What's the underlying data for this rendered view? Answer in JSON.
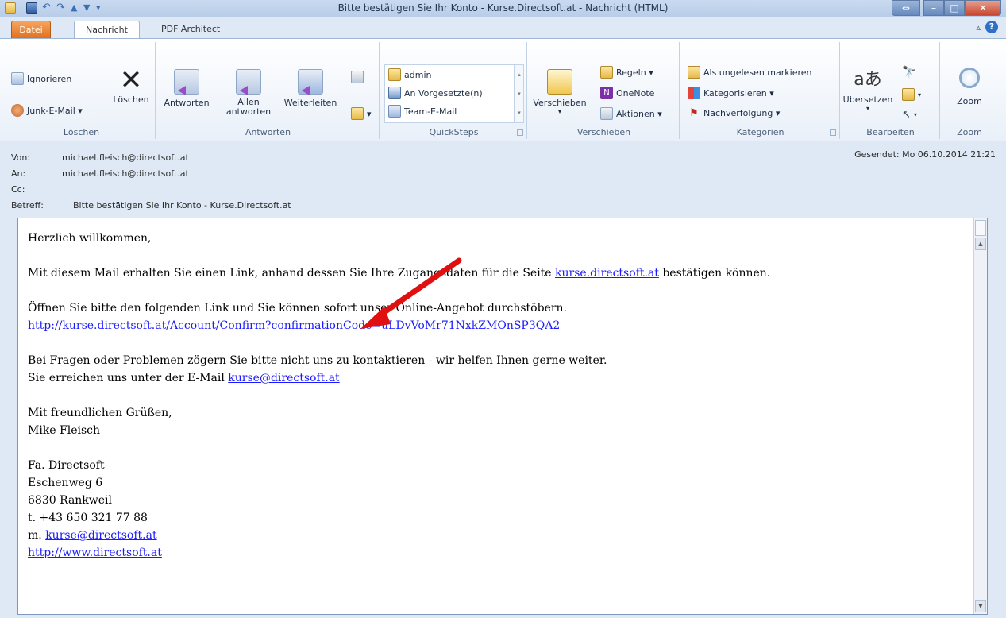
{
  "window": {
    "title": "Bitte bestätigen Sie Ihr Konto - Kurse.Directsoft.at  -  Nachricht (HTML)"
  },
  "tabs": {
    "datei": "Datei",
    "nachricht": "Nachricht",
    "pdf": "PDF Architect"
  },
  "ribbon": {
    "loeschen": {
      "ignorieren": "Ignorieren",
      "junk": "Junk-E-Mail ▾",
      "loeschen": "Löschen",
      "label": "Löschen"
    },
    "antworten": {
      "antworten": "Antworten",
      "allen_line1": "Allen",
      "allen_line2": "antworten",
      "weiterleiten": "Weiterleiten",
      "label": "Antworten"
    },
    "quicksteps": {
      "items": [
        "admin",
        "An Vorgesetzte(n)",
        "Team-E-Mail"
      ],
      "label": "QuickSteps"
    },
    "verschieben": {
      "verschieben": "Verschieben",
      "regeln": "Regeln ▾",
      "onenote": "OneNote",
      "aktionen": "Aktionen ▾",
      "label": "Verschieben"
    },
    "kategorien": {
      "ungelesen": "Als ungelesen markieren",
      "kategorisieren": "Kategorisieren ▾",
      "nachverfolgung": "Nachverfolgung ▾",
      "label": "Kategorien"
    },
    "bearbeiten": {
      "uebersetzen": "Übersetzen",
      "label": "Bearbeiten"
    },
    "zoom": {
      "zoom": "Zoom",
      "label": "Zoom"
    }
  },
  "header": {
    "von_label": "Von:",
    "von_value": "michael.fleisch@directsoft.at",
    "an_label": "An:",
    "an_value": "michael.fleisch@directsoft.at",
    "cc_label": "Cc:",
    "betreff_label": "Betreff:",
    "betreff_value": "Bitte bestätigen Sie Ihr Konto - Kurse.Directsoft.at",
    "gesendet": "Gesendet:   Mo 06.10.2014 21:21"
  },
  "body": {
    "greeting": "Herzlich willkommen,",
    "line1_pre": "Mit diesem Mail erhalten Sie einen Link, anhand dessen Sie Ihre Zugangsdaten für die Seite ",
    "line1_link": "kurse.directsoft.at",
    "line1_post": " bestätigen können.",
    "line2": "Öffnen Sie bitte den folgenden Link und Sie können sofort unser Online-Angebot durchstöbern.",
    "confirm_link": "http://kurse.directsoft.at/Account/Confirm?confirmationCode=uLDvVoMr71NxkZMOnSP3QA2",
    "line3": "Bei Fragen oder Problemen zögern Sie bitte nicht uns zu kontaktieren - wir helfen Ihnen gerne weiter.",
    "line4_pre": "Sie erreichen uns unter der E-Mail ",
    "line4_link": "kurse@directsoft.at",
    "closing": "Mit freundlichen Grüßen,",
    "name": "Mike Fleisch",
    "company": "Fa. Directsoft",
    "street": "Eschenweg 6",
    "city": "6830 Rankweil",
    "phone": "t. +43 650 321 77 88",
    "mail_prefix": "m. ",
    "mail_link": "kurse@directsoft.at",
    "web_link": "http://www.directsoft.at"
  },
  "colors": {
    "accent": "#e36f1e",
    "link": "#1a1aff",
    "annotation_arrow": "#e01010"
  }
}
